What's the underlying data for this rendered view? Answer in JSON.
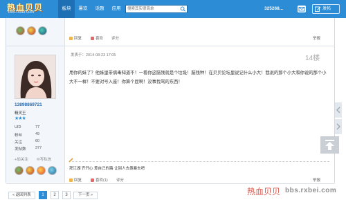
{
  "header": {
    "logo_text": "热血贝贝",
    "logo_url": "bbs.rxbei.com",
    "nav": [
      "板块",
      "暑欢",
      "话题",
      "应用"
    ],
    "search_placeholder": "搜索其实很简单",
    "user_name": "325268...",
    "post_button": "发帖"
  },
  "prev_post": {
    "actions": [
      "回复",
      "喜欢",
      "评分"
    ],
    "report": "举报"
  },
  "post": {
    "time": "发表于：2014-08-23 17:05",
    "floor": "14楼",
    "body": "用你的妹了？他妹里带病毒知道不！一看你这脑残就是个垃圾！脑残种！在贝贝论坛里说记什么小大！我说的那个小大和你说的那个小大不一样！不要对号入座！你算个屁啊！没事找骂的东西！",
    "signature": "拜江湖   齐开心   差自己的路   让别人去愚暴去吧",
    "actions": [
      "回复",
      "喜欢(1)",
      "评分"
    ],
    "report": "举报"
  },
  "author": {
    "name": "13898869721",
    "rank": "精灵王",
    "stars": "★★★",
    "stats": [
      {
        "label": "UID",
        "value": "77"
      },
      {
        "label": "粉丝",
        "value": "49"
      },
      {
        "label": "关注",
        "value": "60"
      },
      {
        "label": "发帖数",
        "value": "377"
      }
    ],
    "follow": "+加关注",
    "message": "写私信"
  },
  "pager": {
    "prev": "« 返回列表",
    "pages": [
      "1",
      "2",
      "3"
    ],
    "current": "1",
    "next": "下一页 »"
  },
  "watermark": {
    "text": "热血贝贝",
    "url": "bbs.rxbei.com"
  },
  "colors": {
    "brand_blue": "#2c8cd6",
    "nav_active": "#1e6fb3"
  },
  "icons": [
    "search-icon",
    "mail-icon",
    "edit-icon",
    "medal-icon",
    "reply-icon",
    "like-icon",
    "rate-icon",
    "pencil-icon",
    "back-to-top-icon"
  ]
}
